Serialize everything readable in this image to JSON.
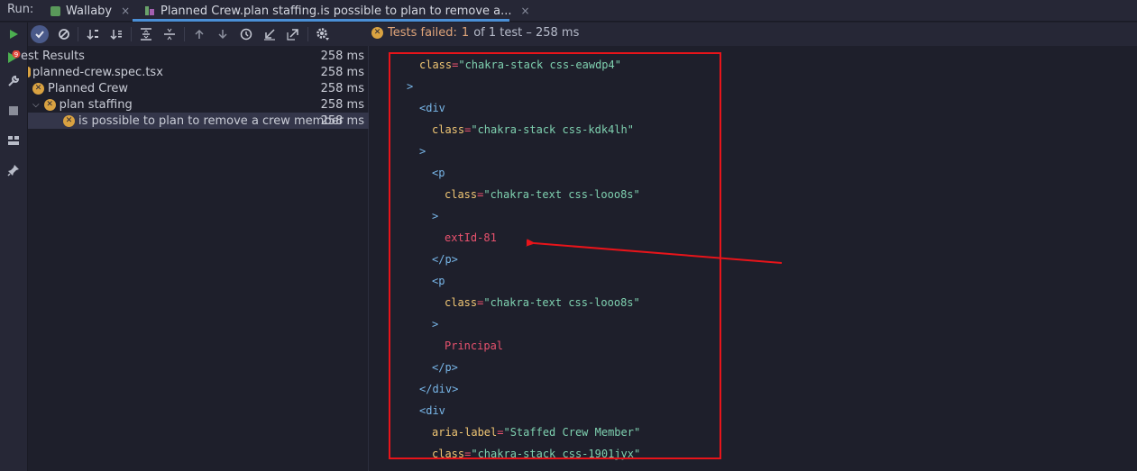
{
  "tabbar": {
    "run_label": "Run:",
    "tabs": [
      {
        "label": "Wallaby",
        "active": false
      },
      {
        "label": "Planned Crew.plan staffing.is possible to plan to remove a...",
        "active": true
      }
    ],
    "close_glyph": "×"
  },
  "gutter": {
    "badge": "9",
    "icons": [
      "wallaby-run-icon",
      "wrench-icon",
      "stop-icon",
      "layout-icon",
      "pin-icon"
    ]
  },
  "toolbar": {
    "icons": [
      "run-icon",
      "check-icon",
      "no-icon",
      "sort-desc-icon",
      "sort-asc-icon",
      "expand-all-icon",
      "collapse-all-icon",
      "up-icon",
      "down-icon",
      "history-icon",
      "import-icon",
      "export-icon",
      "settings-icon"
    ]
  },
  "status": {
    "prefix": "Tests failed:",
    "failed_count": "1",
    "rest": "of 1 test – 258 ms"
  },
  "tree": [
    {
      "label": "est Results",
      "time": "258 ms"
    },
    {
      "label": "planned-crew.spec.tsx",
      "time": "258 ms"
    },
    {
      "label": "Planned Crew",
      "time": "258 ms"
    },
    {
      "label": "plan staffing",
      "time": "258 ms"
    },
    {
      "label": "is possible to plan to remove a crew member",
      "time": "258 ms"
    }
  ],
  "code_lines": [
    {
      "indent": 1,
      "parts": [
        {
          "t": "attr",
          "v": "class"
        },
        {
          "t": "eq",
          "v": "="
        },
        {
          "t": "str",
          "v": "\"chakra-stack css-eawdp4\""
        }
      ]
    },
    {
      "indent": 0,
      "parts": [
        {
          "t": "tag",
          "v": ">"
        }
      ]
    },
    {
      "indent": 1,
      "parts": [
        {
          "t": "tag",
          "v": "<div"
        }
      ]
    },
    {
      "indent": 2,
      "parts": [
        {
          "t": "attr",
          "v": "class"
        },
        {
          "t": "eq",
          "v": "="
        },
        {
          "t": "str",
          "v": "\"chakra-stack css-kdk4lh\""
        }
      ]
    },
    {
      "indent": 1,
      "parts": [
        {
          "t": "tag",
          "v": ">"
        }
      ]
    },
    {
      "indent": 2,
      "parts": [
        {
          "t": "tag",
          "v": "<p"
        }
      ]
    },
    {
      "indent": 3,
      "parts": [
        {
          "t": "attr",
          "v": "class"
        },
        {
          "t": "eq",
          "v": "="
        },
        {
          "t": "str",
          "v": "\"chakra-text css-looo8s\""
        }
      ]
    },
    {
      "indent": 2,
      "parts": [
        {
          "t": "tag",
          "v": ">"
        }
      ]
    },
    {
      "indent": 3,
      "parts": [
        {
          "t": "txt",
          "v": "extId-81"
        }
      ]
    },
    {
      "indent": 2,
      "parts": [
        {
          "t": "tag",
          "v": "</p>"
        }
      ]
    },
    {
      "indent": 2,
      "parts": [
        {
          "t": "tag",
          "v": "<p"
        }
      ]
    },
    {
      "indent": 3,
      "parts": [
        {
          "t": "attr",
          "v": "class"
        },
        {
          "t": "eq",
          "v": "="
        },
        {
          "t": "str",
          "v": "\"chakra-text css-looo8s\""
        }
      ]
    },
    {
      "indent": 2,
      "parts": [
        {
          "t": "tag",
          "v": ">"
        }
      ]
    },
    {
      "indent": 3,
      "parts": [
        {
          "t": "txt",
          "v": "Principal"
        }
      ]
    },
    {
      "indent": 2,
      "parts": [
        {
          "t": "tag",
          "v": "</p>"
        }
      ]
    },
    {
      "indent": 1,
      "parts": [
        {
          "t": "tag",
          "v": "</div>"
        }
      ]
    },
    {
      "indent": 1,
      "parts": [
        {
          "t": "tag",
          "v": "<div"
        }
      ]
    },
    {
      "indent": 2,
      "parts": [
        {
          "t": "attr",
          "v": "aria-label"
        },
        {
          "t": "eq",
          "v": "="
        },
        {
          "t": "str",
          "v": "\"Staffed Crew Member\""
        }
      ]
    },
    {
      "indent": 2,
      "parts": [
        {
          "t": "attr",
          "v": "class"
        },
        {
          "t": "eq",
          "v": "="
        },
        {
          "t": "str",
          "v": "\"chakra-stack css-1901jyx\""
        }
      ]
    }
  ],
  "colors": {
    "background": "#1e1f2b",
    "panel": "#262736",
    "annotation_red": "#e8141a",
    "fail_orange": "#d9a241",
    "string_green": "#7fd1b0",
    "attr_yellow": "#f0c674",
    "tag_blue": "#78b6e8",
    "text_red": "#e8526e"
  }
}
